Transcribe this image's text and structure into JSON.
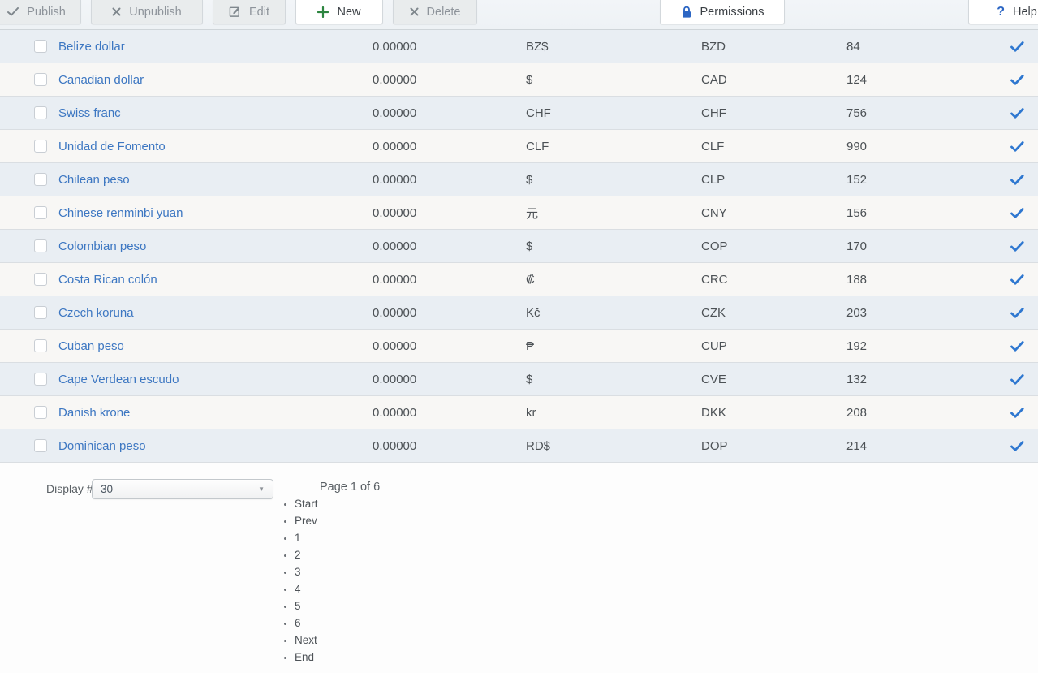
{
  "toolbar": {
    "publish": "Publish",
    "unpublish": "Unpublish",
    "edit": "Edit",
    "new": "New",
    "delete": "Delete",
    "permissions": "Permissions",
    "help": "Help",
    "icons": {
      "publish": "check-icon",
      "unpublish": "x-icon",
      "edit": "edit-icon",
      "new": "plus-icon",
      "delete": "x-icon",
      "permissions": "lock-icon",
      "help": "question-icon"
    }
  },
  "table": {
    "rows": [
      {
        "name": "Belize dollar",
        "value": "0.00000",
        "symbol": "BZ$",
        "code": "BZD",
        "number": "84",
        "published": true
      },
      {
        "name": "Canadian dollar",
        "value": "0.00000",
        "symbol": "$",
        "code": "CAD",
        "number": "124",
        "published": true
      },
      {
        "name": "Swiss franc",
        "value": "0.00000",
        "symbol": "CHF",
        "code": "CHF",
        "number": "756",
        "published": true
      },
      {
        "name": "Unidad de Fomento",
        "value": "0.00000",
        "symbol": "CLF",
        "code": "CLF",
        "number": "990",
        "published": true
      },
      {
        "name": "Chilean peso",
        "value": "0.00000",
        "symbol": "$",
        "code": "CLP",
        "number": "152",
        "published": true
      },
      {
        "name": "Chinese renminbi yuan",
        "value": "0.00000",
        "symbol": "元",
        "code": "CNY",
        "number": "156",
        "published": true
      },
      {
        "name": "Colombian peso",
        "value": "0.00000",
        "symbol": "$",
        "code": "COP",
        "number": "170",
        "published": true
      },
      {
        "name": "Costa Rican colón",
        "value": "0.00000",
        "symbol": "₡",
        "code": "CRC",
        "number": "188",
        "published": true
      },
      {
        "name": "Czech koruna",
        "value": "0.00000",
        "symbol": "Kč",
        "code": "CZK",
        "number": "203",
        "published": true
      },
      {
        "name": "Cuban peso",
        "value": "0.00000",
        "symbol": "₱",
        "code": "CUP",
        "number": "192",
        "published": true
      },
      {
        "name": "Cape Verdean escudo",
        "value": "0.00000",
        "symbol": "$",
        "code": "CVE",
        "number": "132",
        "published": true
      },
      {
        "name": "Danish krone",
        "value": "0.00000",
        "symbol": "kr",
        "code": "DKK",
        "number": "208",
        "published": true
      },
      {
        "name": "Dominican peso",
        "value": "0.00000",
        "symbol": "RD$",
        "code": "DOP",
        "number": "214",
        "published": true
      }
    ]
  },
  "footer": {
    "display_label": "Display #",
    "display_value": "30",
    "page_status": "Page 1 of 6",
    "pagination": [
      "Start",
      "Prev",
      "1",
      "2",
      "3",
      "4",
      "5",
      "6",
      "Next",
      "End"
    ]
  },
  "colors": {
    "link_blue": "#3d77c2",
    "published_check_blue": "#2e77d0",
    "accent_blue": "#2c66c4",
    "new_plus_green": "#2d8540",
    "row_alt_blue": "#e9eef3",
    "row_alt_white": "#f8f7f5",
    "disabled_button_text": "#8e949b"
  }
}
